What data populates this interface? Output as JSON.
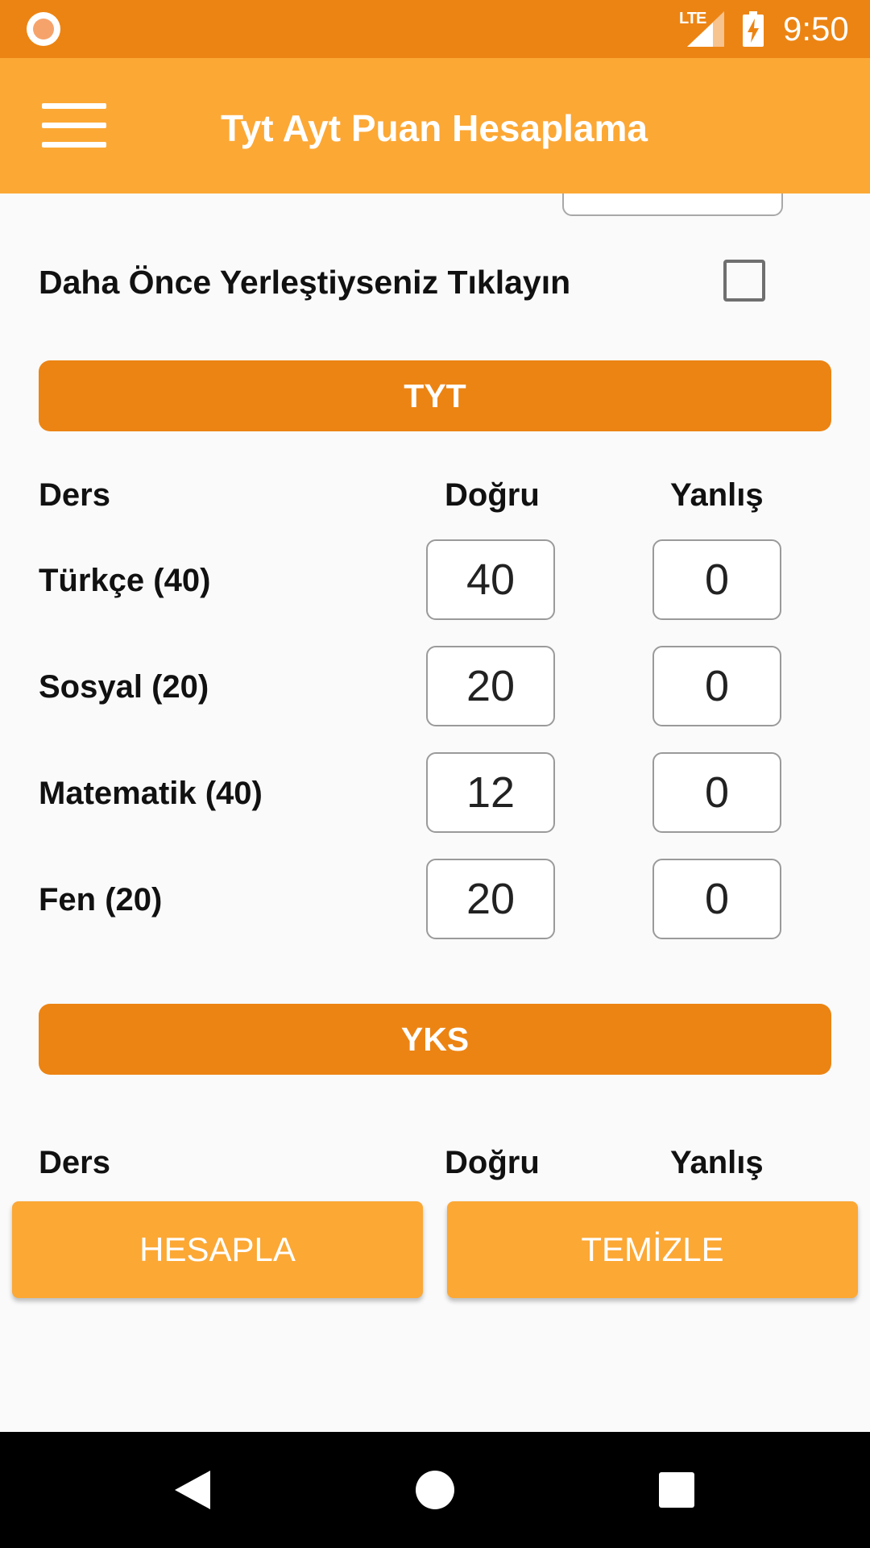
{
  "status_bar": {
    "network": "LTE",
    "time": "9:50",
    "icons": [
      "record-indicator-icon",
      "lte-signal-icon",
      "battery-charging-icon"
    ]
  },
  "app_bar": {
    "title": "Tyt Ayt Puan Hesaplama",
    "menu_icon": "hamburger-menu-icon"
  },
  "placement": {
    "label": "Daha Önce Yerleştiyseniz Tıklayın",
    "checked": false
  },
  "tyt": {
    "header": "TYT",
    "columns": {
      "subject": "Ders",
      "correct": "Doğru",
      "wrong": "Yanlış"
    },
    "rows": [
      {
        "label": "Türkçe (40)",
        "correct": "40",
        "wrong": "0"
      },
      {
        "label": "Sosyal (20)",
        "correct": "20",
        "wrong": "0"
      },
      {
        "label": "Matematik (40)",
        "correct": "12",
        "wrong": "0"
      },
      {
        "label": "Fen (20)",
        "correct": "20",
        "wrong": "0"
      }
    ]
  },
  "yks": {
    "header": "YKS",
    "columns": {
      "subject": "Ders",
      "correct": "Doğru",
      "wrong": "Yanlış"
    }
  },
  "actions": {
    "calculate": "HESAPLA",
    "clear": "TEMİZLE"
  },
  "colors": {
    "status_bar": "#ec8413",
    "app_bar": "#fca835",
    "section_header": "#ec8413",
    "action_button": "#fca835"
  }
}
